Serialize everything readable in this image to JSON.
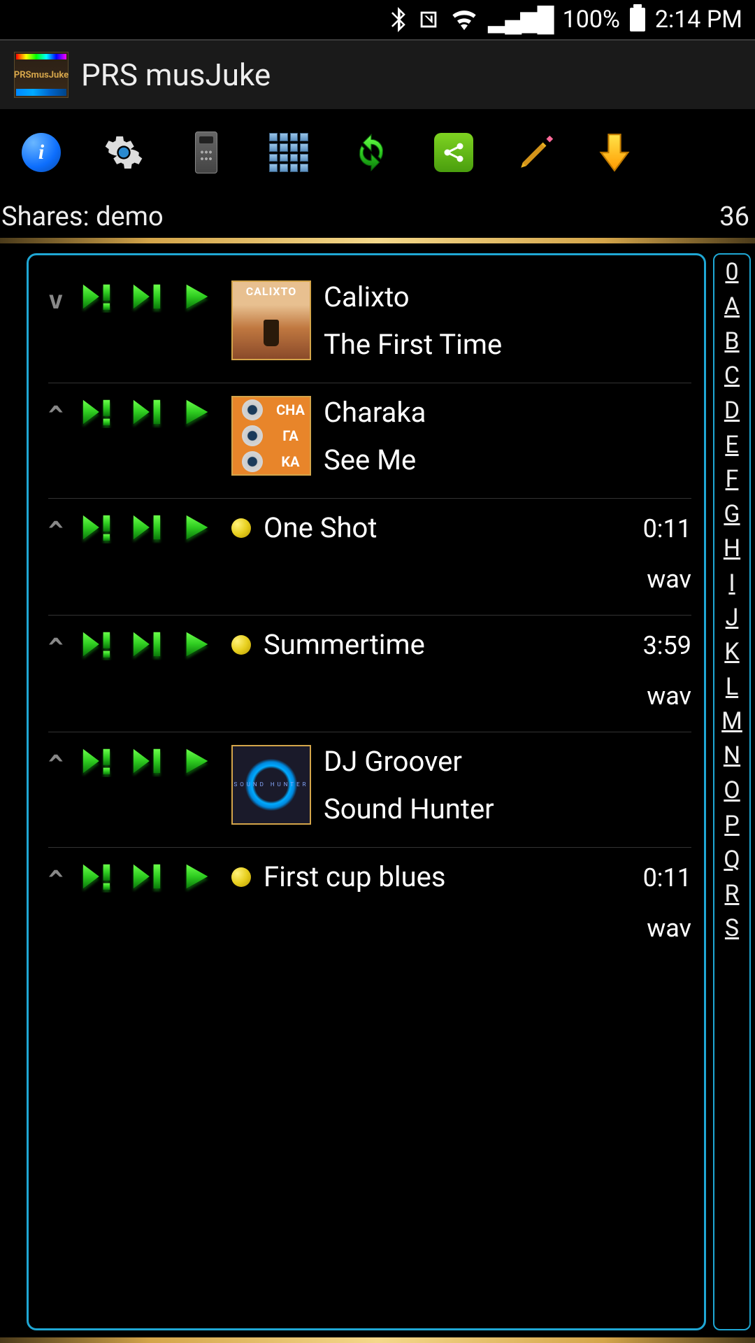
{
  "status": {
    "battery": "100%",
    "time": "2:14 PM"
  },
  "app": {
    "title": "PRS musJuke",
    "logo_text": "PRSmusJuke"
  },
  "shares": {
    "label": "Shares: demo",
    "count": "36"
  },
  "tracks": [
    {
      "caret": "v",
      "artist": "Calixto",
      "title": "The First Time",
      "art": "calixto",
      "dur": "",
      "fmt": ""
    },
    {
      "caret": "^",
      "artist": "Charaka",
      "title": "See Me",
      "art": "charaka",
      "dur": "",
      "fmt": ""
    },
    {
      "caret": "^",
      "artist": "",
      "title": "One Shot",
      "art": "dot",
      "dur": "0:11",
      "fmt": "wav"
    },
    {
      "caret": "^",
      "artist": "",
      "title": "Summertime",
      "art": "dot",
      "dur": "3:59",
      "fmt": "wav"
    },
    {
      "caret": "^",
      "artist": "DJ Groover",
      "title": "Sound Hunter",
      "art": "dj",
      "dur": "",
      "fmt": ""
    },
    {
      "caret": "^",
      "artist": "",
      "title": "First cup blues",
      "art": "dot",
      "dur": "0:11",
      "fmt": "wav"
    }
  ],
  "az": [
    "0",
    "A",
    "B",
    "C",
    "D",
    "E",
    "F",
    "G",
    "H",
    "I",
    "J",
    "K",
    "L",
    "M",
    "N",
    "O",
    "P",
    "Q",
    "R",
    "S"
  ]
}
